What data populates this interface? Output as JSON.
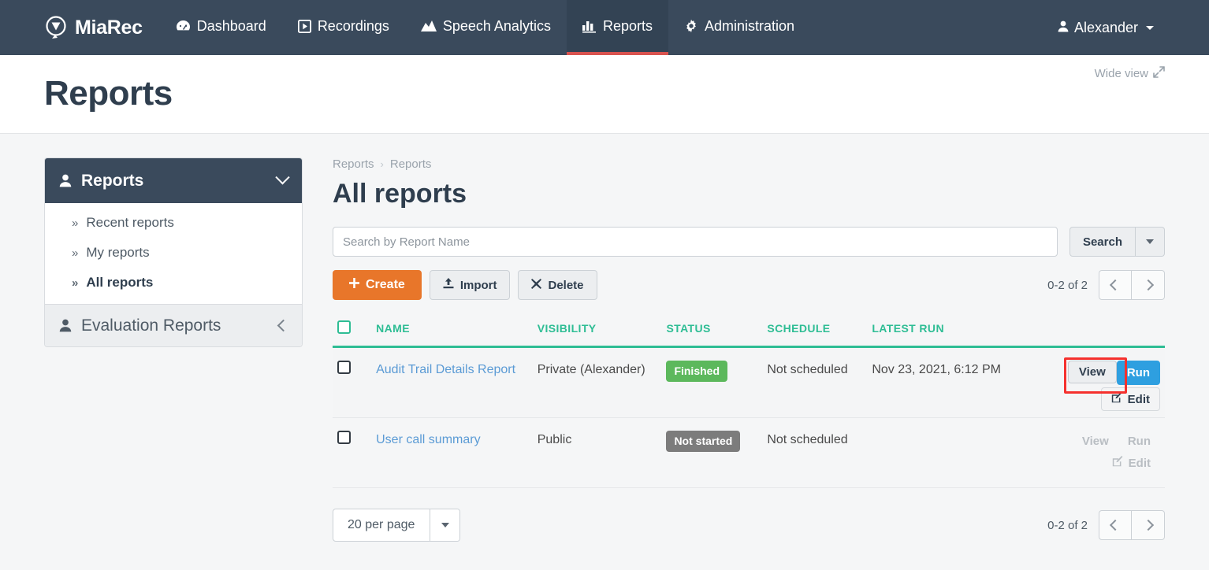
{
  "navbar": {
    "brand": "MiaRec",
    "items": [
      {
        "label": "Dashboard",
        "icon": "dashboard-icon",
        "active": false
      },
      {
        "label": "Recordings",
        "icon": "play-box-icon",
        "active": false
      },
      {
        "label": "Speech Analytics",
        "icon": "chart-area-icon",
        "active": false
      },
      {
        "label": "Reports",
        "icon": "bar-chart-icon",
        "active": true
      },
      {
        "label": "Administration",
        "icon": "gear-icon",
        "active": false
      }
    ],
    "user": "Alexander",
    "accent_active": "#d9534f",
    "background": "#3a4a5c"
  },
  "page_band": {
    "title": "Reports",
    "wide_view": "Wide view"
  },
  "sidebar": {
    "header": {
      "label": "Reports",
      "icon": "user-icon"
    },
    "items": [
      {
        "label": "Recent reports",
        "bullet": "»",
        "current": false
      },
      {
        "label": "My reports",
        "bullet": "»",
        "current": false
      },
      {
        "label": "All reports",
        "bullet": "»",
        "current": true
      }
    ],
    "sub": {
      "label": "Evaluation Reports",
      "icon": "user-icon"
    }
  },
  "breadcrumb": {
    "first": "Reports",
    "separator": "›",
    "second": "Reports"
  },
  "main": {
    "title": "All reports",
    "search": {
      "placeholder": "Search by Report Name",
      "value": "",
      "button": "Search"
    },
    "toolbar": {
      "create": "Create",
      "import": "Import",
      "delete": "Delete"
    },
    "pager_top": {
      "count": "0-2 of 2",
      "prev": "‹",
      "next": "›"
    },
    "pager_bottom": {
      "count": "0-2 of 2",
      "prev": "‹",
      "next": "›"
    },
    "per_page": "20 per page"
  },
  "table": {
    "headers": [
      "NAME",
      "VISIBILITY",
      "STATUS",
      "SCHEDULE",
      "LATEST RUN"
    ],
    "rows": [
      {
        "name": "Audit Trail Details Report",
        "visibility": "Private (Alexander)",
        "status": "Finished",
        "status_color": "#5cb85c",
        "schedule": "Not scheduled",
        "latest_run": "Nov 23, 2021, 6:12 PM",
        "actions": {
          "view": "View",
          "run": "Run",
          "edit": "Edit"
        },
        "enabled": true,
        "highlighted": true
      },
      {
        "name": "User call summary",
        "visibility": "Public",
        "status": "Not started",
        "status_color": "#7c7c7c",
        "schedule": "Not scheduled",
        "latest_run": "",
        "actions": {
          "view": "View",
          "run": "Run",
          "edit": "Edit"
        },
        "enabled": false,
        "highlighted": false
      }
    ]
  },
  "colors": {
    "brand_dark": "#3a4a5c",
    "create_orange": "#e8762a",
    "table_header_teal": "#2ebd94",
    "run_blue": "#2e9fe0",
    "highlight_red": "#f5312e",
    "link_blue": "#5b9bd5"
  }
}
